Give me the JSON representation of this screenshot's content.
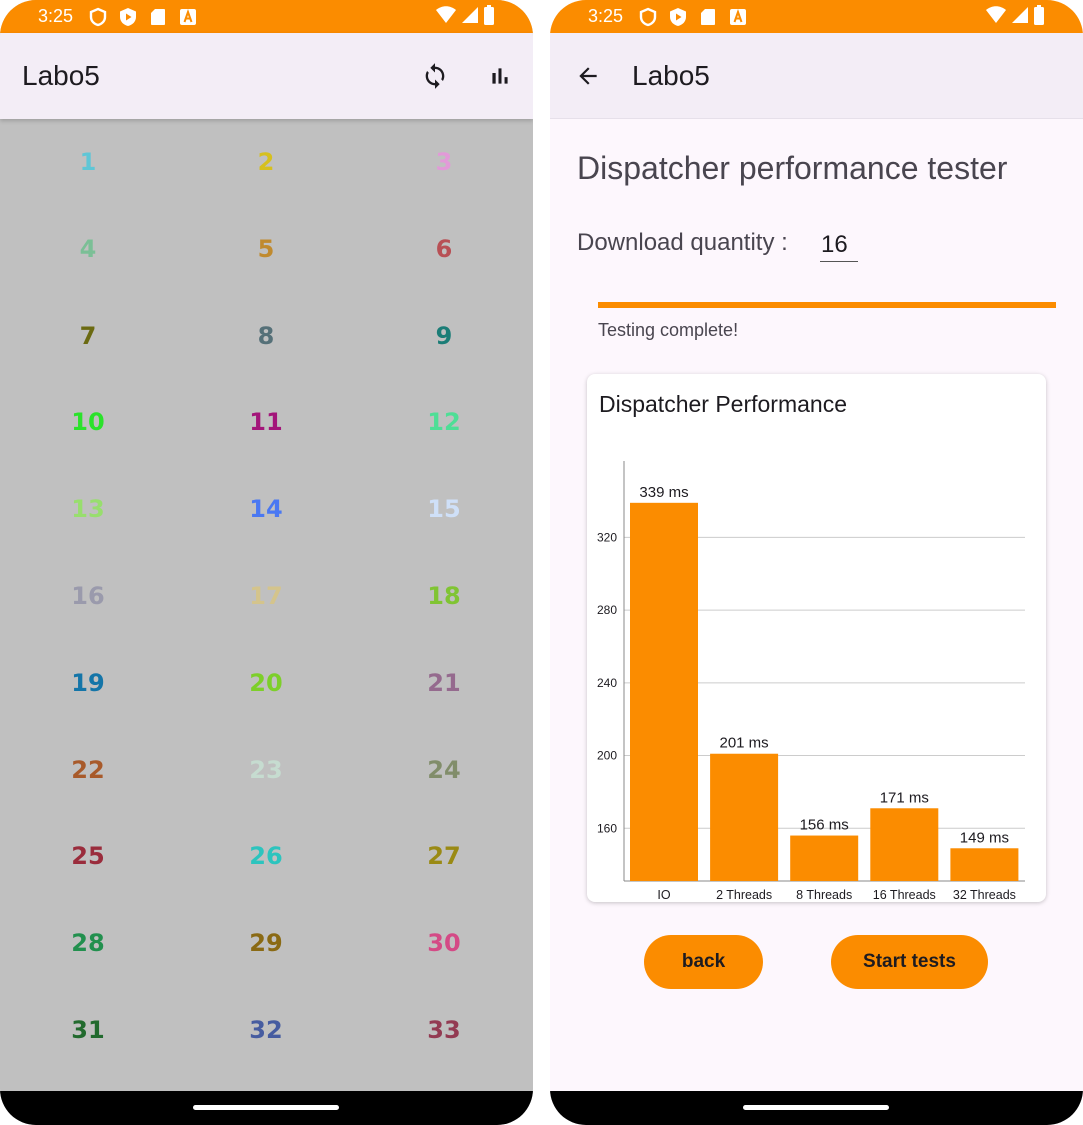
{
  "colors": {
    "accent": "#fb8c00",
    "appbar": "#f3edf6",
    "grid_background": "#c0c0c0",
    "right_background": "#fdf7fd"
  },
  "left": {
    "status": {
      "time": "3:25",
      "left_icons": [
        "shield-icon",
        "play-protect-icon",
        "sd-card-icon",
        "font-a-icon"
      ],
      "right_icons": [
        "wifi-icon",
        "signal-icon",
        "battery-icon"
      ]
    },
    "app_title": "Labo5",
    "actions": [
      "refresh-icon",
      "bar-chart-icon"
    ],
    "grid_items": [
      {
        "label": "1",
        "color": "#5fc6d6"
      },
      {
        "label": "2",
        "color": "#d6c01e"
      },
      {
        "label": "3",
        "color": "#e29ad8"
      },
      {
        "label": "4",
        "color": "#7bbf96"
      },
      {
        "label": "5",
        "color": "#c08a2e"
      },
      {
        "label": "6",
        "color": "#b85055"
      },
      {
        "label": "7",
        "color": "#6b6a11"
      },
      {
        "label": "8",
        "color": "#557078"
      },
      {
        "label": "9",
        "color": "#1b7d77"
      },
      {
        "label": "10",
        "color": "#2be22b"
      },
      {
        "label": "11",
        "color": "#a3157a"
      },
      {
        "label": "12",
        "color": "#4fde96"
      },
      {
        "label": "13",
        "color": "#98de6e"
      },
      {
        "label": "14",
        "color": "#4a78f2"
      },
      {
        "label": "15",
        "color": "#cfe0f8"
      },
      {
        "label": "16",
        "color": "#9a9aac"
      },
      {
        "label": "17",
        "color": "#d4c48c"
      },
      {
        "label": "18",
        "color": "#80c433"
      },
      {
        "label": "19",
        "color": "#1475a8"
      },
      {
        "label": "20",
        "color": "#7dcf2a"
      },
      {
        "label": "21",
        "color": "#956a8e"
      },
      {
        "label": "22",
        "color": "#a85a2a"
      },
      {
        "label": "23",
        "color": "#c6dcd0"
      },
      {
        "label": "24",
        "color": "#818d6a"
      },
      {
        "label": "25",
        "color": "#9a2c3c"
      },
      {
        "label": "26",
        "color": "#2cc4be"
      },
      {
        "label": "27",
        "color": "#9a8a14"
      },
      {
        "label": "28",
        "color": "#22904e"
      },
      {
        "label": "29",
        "color": "#8a6a14"
      },
      {
        "label": "30",
        "color": "#d44a86"
      },
      {
        "label": "31",
        "color": "#226a2e"
      },
      {
        "label": "32",
        "color": "#465ca0"
      },
      {
        "label": "33",
        "color": "#933a52"
      }
    ]
  },
  "right": {
    "status": {
      "time": "3:25",
      "left_icons": [
        "shield-icon",
        "play-protect-icon",
        "sd-card-icon",
        "font-a-icon"
      ],
      "right_icons": [
        "wifi-icon",
        "signal-icon",
        "battery-icon"
      ]
    },
    "app_title": "Labo5",
    "back_icon": "arrow-back-icon",
    "heading": "Dispatcher performance tester",
    "download_label": "Download quantity :",
    "download_value": "16",
    "progress": 1.0,
    "status_text": "Testing complete!",
    "back_button": "back",
    "start_button": "Start tests"
  },
  "chart_data": {
    "type": "bar",
    "title": "Dispatcher Performance",
    "categories": [
      "IO",
      "2 Threads",
      "8 Threads",
      "16 Threads",
      "32 Threads"
    ],
    "values": [
      339,
      201,
      156,
      171,
      149
    ],
    "value_labels": [
      "339 ms",
      "201 ms",
      "156 ms",
      "171 ms",
      "149 ms"
    ],
    "yticks": [
      "160",
      "200",
      "240",
      "280",
      "320"
    ],
    "ylim": [
      131,
      362
    ],
    "grid": true,
    "legend": "none",
    "color": "#fb8c00"
  }
}
